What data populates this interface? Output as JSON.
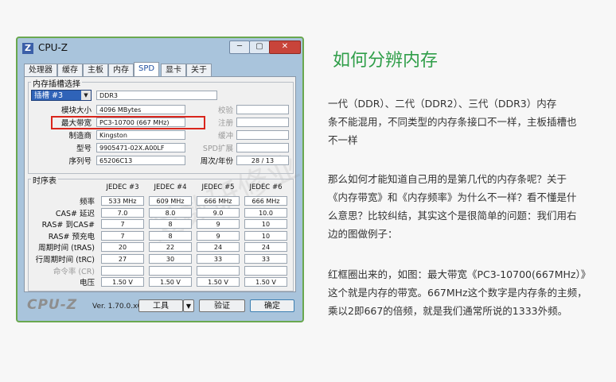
{
  "window": {
    "app_title": "CPU-Z",
    "logo_letter": "Z",
    "min_label": "─",
    "max_label": "▢",
    "close_label": "✕"
  },
  "tabs": [
    "处理器",
    "缓存",
    "主板",
    "内存",
    "SPD",
    "显卡",
    "关于"
  ],
  "active_tab": "SPD",
  "slot_group": {
    "title": "内存插槽选择",
    "selected_slot": "插槽 #3",
    "memory_type": "DDR3",
    "rows": [
      {
        "label": "模块大小",
        "value": "4096 MBytes",
        "right_label": "校验",
        "right_value": ""
      },
      {
        "label": "最大带宽",
        "value": "PC3-10700 (667 MHz)",
        "right_label": "注册",
        "right_value": ""
      },
      {
        "label": "制造商",
        "value": "Kingston",
        "right_label": "缓冲",
        "right_value": ""
      },
      {
        "label": "型号",
        "value": "9905471-02X.A00LF",
        "right_label": "SPD扩展",
        "right_value": ""
      },
      {
        "label": "序列号",
        "value": "65206C13",
        "right_label": "周次/年份",
        "right_value": "28 / 13"
      }
    ]
  },
  "timing_group": {
    "title": "时序表",
    "columns": [
      "JEDEC #3",
      "JEDEC #4",
      "JEDEC #5",
      "JEDEC #6"
    ],
    "rows": [
      {
        "label": "频率",
        "values": [
          "533 MHz",
          "609 MHz",
          "666 MHz",
          "666 MHz"
        ],
        "dim": false
      },
      {
        "label": "CAS# 延迟",
        "values": [
          "7.0",
          "8.0",
          "9.0",
          "10.0"
        ],
        "dim": false
      },
      {
        "label": "RAS# 到CAS#",
        "values": [
          "7",
          "8",
          "9",
          "10"
        ],
        "dim": false
      },
      {
        "label": "RAS# 预充电",
        "values": [
          "7",
          "8",
          "9",
          "10"
        ],
        "dim": false
      },
      {
        "label": "周期时间 (tRAS)",
        "values": [
          "20",
          "22",
          "24",
          "24"
        ],
        "dim": false
      },
      {
        "label": "行周期时间 (tRC)",
        "values": [
          "27",
          "30",
          "33",
          "33"
        ],
        "dim": false
      },
      {
        "label": "命令率 (CR)",
        "values": [
          "",
          "",
          "",
          ""
        ],
        "dim": true
      },
      {
        "label": "电压",
        "values": [
          "1.50 V",
          "1.50 V",
          "1.50 V",
          "1.50 V"
        ],
        "dim": false
      }
    ]
  },
  "footer": {
    "logo": "CPU-Z",
    "version": "Ver. 1.70.0.x64",
    "tools_label": "工具",
    "tools_arrow": "▼",
    "verify_label": "验证",
    "ok_label": "确定"
  },
  "article": {
    "title": "如何分辨内存",
    "para1": [
      "一代（DDR）、二代（DDR2）、三代（DDR3）内存",
      "条不能混用，不同类型的内存条接口不一样，主板插槽也",
      "不一样"
    ],
    "para2": [
      "那么如何才能知道自己用的是第几代的内存条呢？关于",
      "《内存带宽》和《内存频率》为什么不一样？看不懂是什",
      "么意思？比较纠结，其实这个是很简单的问题：我们用右",
      "边的图做例子："
    ],
    "para3": [
      "红框圈出来的，如图：最大带宽《PC3-10700(667MHz）》",
      "这个就是内存的带宽。667MHz这个数字是内存条的主频，",
      "乘以2即667的倍频，就是我们通常所说的1333外频。"
    ]
  }
}
